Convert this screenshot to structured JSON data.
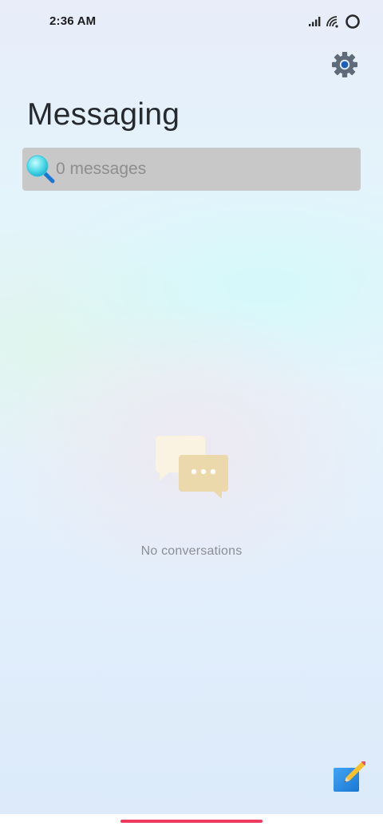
{
  "status_bar": {
    "time": "2:36 AM",
    "icons": [
      "signal-icon",
      "wifi-icon",
      "circle-status-icon"
    ]
  },
  "header": {
    "title": "Messaging",
    "settings_icon": "gear-icon"
  },
  "search": {
    "placeholder": "0 messages",
    "value": "",
    "icon": "search-icon"
  },
  "empty_state": {
    "icon": "chat-bubbles-icon",
    "text": "No conversations"
  },
  "actions": {
    "compose_icon": "compose-icon"
  },
  "colors": {
    "accent_pink": "#ee3a5d",
    "search_bg": "#c8c8c8",
    "title_text": "#262a2f",
    "compose_blue": "#2196f3",
    "gear_gray": "#5f6b78"
  }
}
